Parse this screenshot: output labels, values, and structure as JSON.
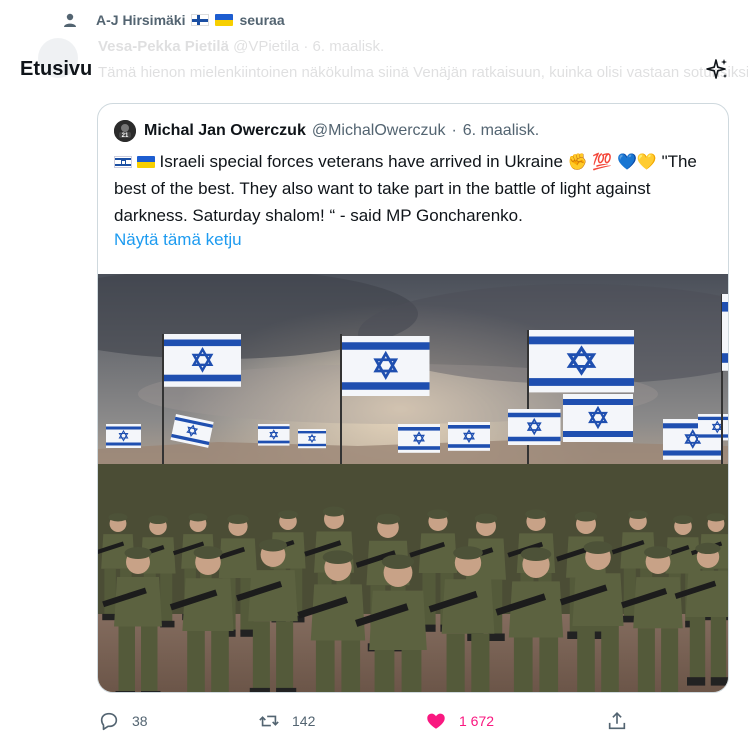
{
  "retweet": {
    "user": "A-J Hirsimäki",
    "action": "seuraa"
  },
  "background_tweet": {
    "name": "Vesa-Pekka Pietilä",
    "meta": "@VPietila · 6. maalisk.",
    "text": "Tämä hienon mielenkiintoinen näkökulma siinä Venäjän ratkaisuun, kuinka olisi vastaan soturisiksi."
  },
  "header": {
    "title": "Etusivu"
  },
  "quote": {
    "name": "Michal Jan Owerczuk",
    "handle": "@MichalOwerczuk",
    "separator": "·",
    "date": "6. maalisk.",
    "text_line1": "Israeli special forces veterans have arrived in Ukraine",
    "emoji_fist": "✊",
    "emoji_100": "💯",
    "emoji_hearts": "💙💛",
    "text_line2": "\"The best of the best. They also want to take part in the battle of light against darkness. Saturday shalom! “ - said MP Goncharenko.",
    "show_thread": "Näytä tämä ketju"
  },
  "actions": {
    "replies": "38",
    "retweets": "142",
    "likes": "1 672"
  },
  "colors": {
    "link": "#1d9bf0",
    "muted": "#536471",
    "like": "#f91880",
    "border": "#cfd9de"
  },
  "icons": [
    "person-icon",
    "sparkle-icon",
    "reply-icon",
    "retweet-icon",
    "heart-icon",
    "share-icon"
  ]
}
